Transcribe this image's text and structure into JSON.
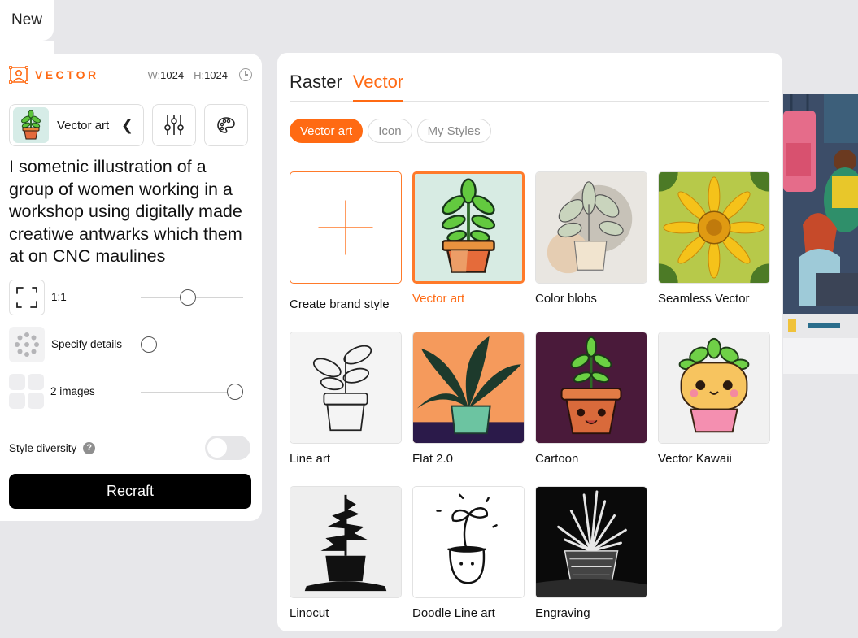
{
  "top": {
    "new_label": "New"
  },
  "left_panel": {
    "brand": "VECTOR",
    "width_label": "W:",
    "width_value": "1024",
    "height_label": "H:",
    "height_value": "1024",
    "style_name": "Vector art",
    "prompt": "I sometnic illustration of a group of women working in a workshop using digitally made creatiwe antwarks which them at on CNC maulines",
    "aspect_label": "1:1",
    "details_label": "Specify details",
    "images_label": "2 images",
    "diversity_label": "Style diversity",
    "help_glyph": "?",
    "diversity_on": false,
    "recraft_label": "Recraft"
  },
  "right_panel": {
    "tabs": [
      {
        "label": "Raster",
        "active": false
      },
      {
        "label": "Vector",
        "active": true
      }
    ],
    "pills": [
      {
        "label": "Vector art",
        "active": true
      },
      {
        "label": "Icon",
        "active": false
      },
      {
        "label": "My Styles",
        "active": false
      }
    ],
    "styles": [
      {
        "name": "Create brand style"
      },
      {
        "name": "Vector art",
        "selected": true
      },
      {
        "name": "Color blobs"
      },
      {
        "name": "Seamless Vector"
      },
      {
        "name": "Line art"
      },
      {
        "name": "Flat 2.0"
      },
      {
        "name": "Cartoon"
      },
      {
        "name": "Vector Kawaii"
      },
      {
        "name": "Linocut"
      },
      {
        "name": "Doodle Line art"
      },
      {
        "name": "Engraving"
      }
    ]
  },
  "colors": {
    "accent": "#ff6a13",
    "button": "#000000"
  }
}
